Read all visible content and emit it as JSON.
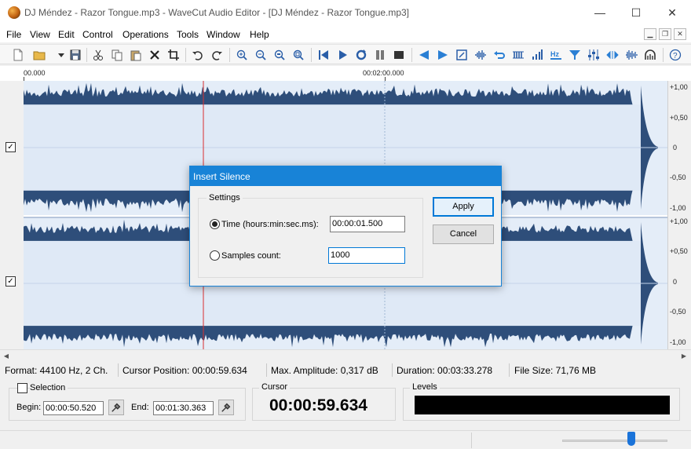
{
  "window": {
    "title": "DJ Méndez - Razor Tongue.mp3 - WaveCut Audio Editor - [DJ Méndez - Razor Tongue.mp3]",
    "minimize": "—",
    "maximize": "☐",
    "close": "✕"
  },
  "menu": {
    "items": [
      "File",
      "View",
      "Edit",
      "Control",
      "Operations",
      "Tools",
      "Window",
      "Help"
    ]
  },
  "ruler": {
    "labels": [
      "00.000",
      "00:02:00.000"
    ]
  },
  "amplitude_scale": [
    "+1,00",
    "+0,50",
    "0",
    "-0,50",
    "-1,00",
    "+1,00",
    "+0,50",
    "0",
    "-0,50",
    "-1,00"
  ],
  "channels": [
    {
      "enabled_mark": "✓"
    },
    {
      "enabled_mark": "✓"
    }
  ],
  "status": {
    "format": "Format: 44100 Hz, 2 Ch.",
    "cursor_position": "Cursor Position: 00:00:59.634",
    "max_amplitude": "Max. Amplitude: 0,317 dB",
    "duration": "Duration: 00:03:33.278",
    "file_size": "File Size: 71,76 MB"
  },
  "selection": {
    "title": "Selection",
    "begin_label": "Begin:",
    "begin_value": "00:00:50.520",
    "end_label": "End:",
    "end_value": "00:01:30.363"
  },
  "cursor_panel": {
    "title": "Cursor",
    "time": "00:00:59.634"
  },
  "levels_panel": {
    "title": "Levels"
  },
  "dialog": {
    "title": "Insert Silence",
    "group_title": "Settings",
    "time_label": "Time (hours:min:sec.ms):",
    "time_value": "00:00:01.500",
    "samples_label": "Samples count:",
    "samples_value": "1000",
    "apply": "Apply",
    "cancel": "Cancel",
    "selected_option": "time"
  },
  "colors": {
    "waveform": "#2e4e7a",
    "waveform_bg": "#e4edf8",
    "cursor_line": "#d93030",
    "dialog_accent": "#1883d7"
  }
}
